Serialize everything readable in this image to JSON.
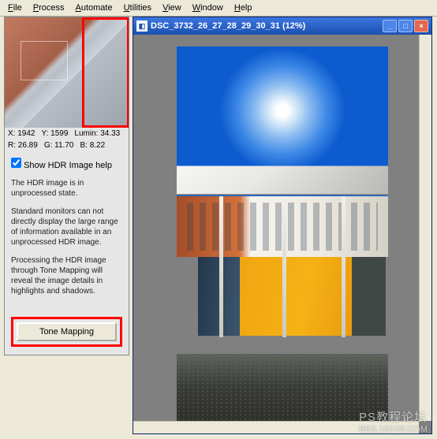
{
  "menubar": {
    "items": [
      {
        "label": "File",
        "accel": "F"
      },
      {
        "label": "Process",
        "accel": "P"
      },
      {
        "label": "Automate",
        "accel": "A"
      },
      {
        "label": "Utilities",
        "accel": "U"
      },
      {
        "label": "View",
        "accel": "V"
      },
      {
        "label": "Window",
        "accel": "W"
      },
      {
        "label": "Help",
        "accel": "H"
      }
    ]
  },
  "preview": {
    "coords": {
      "x_label": "X:",
      "x": "1942",
      "y_label": "Y:",
      "y": "1599",
      "lumin_label": "Lumin:",
      "lumin": "34.33",
      "r_label": "R:",
      "r": "26.89",
      "g_label": "G:",
      "g": "11.70",
      "b_label": "B:",
      "b": "8.22"
    }
  },
  "help": {
    "checkbox_label": "Show HDR Image help",
    "p1": "The HDR image is in unprocessed state.",
    "p2": "Standard monitors can not directly display the large range of information available in an unprocessed HDR image.",
    "p3": "Processing the HDR image through Tone Mapping will reveal the image details in highlights and shadows.",
    "button_label": "Tone Mapping"
  },
  "image_window": {
    "title": "DSC_3732_26_27_28_29_30_31 (12%)"
  },
  "watermark": {
    "line1": "PS教程论坛",
    "line2": "BBS.16XX8.COM"
  }
}
